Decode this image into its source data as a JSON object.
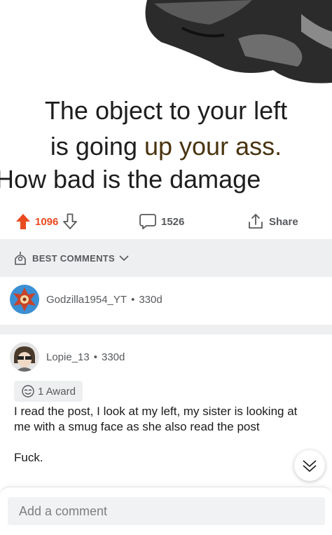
{
  "meme": {
    "line1": "The object to your left",
    "line2_pre": "is going ",
    "line2_hl": "up your ass.",
    "line3": "How bad is the damage"
  },
  "actions": {
    "upvotes": "1096",
    "comments": "1526",
    "share": "Share",
    "upvote_color": "#ea4a1f"
  },
  "sort": {
    "label": "BEST COMMENTS"
  },
  "comments": [
    {
      "author": "Godzilla1954_YT",
      "age": "330d"
    },
    {
      "author": "Lopie_13",
      "age": "330d",
      "award": "1 Award",
      "body_line1": "I read the post, I look at my left, my sister is looking at me with a smug face as she also read the post",
      "body_line2": "Fuck."
    }
  ],
  "composer": {
    "placeholder": "Add a comment"
  },
  "icons": [
    "upvote-icon",
    "downvote-icon",
    "comment-icon",
    "share-icon",
    "sort-icon",
    "chevron-down-icon",
    "award-icon",
    "collapse-icon"
  ]
}
